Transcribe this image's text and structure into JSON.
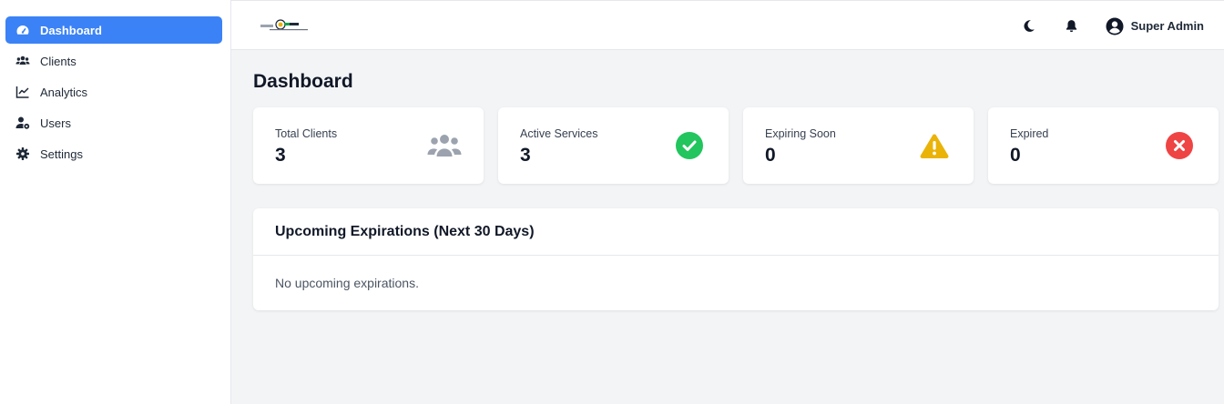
{
  "sidebar": {
    "items": [
      {
        "label": "Dashboard",
        "icon": "gauge-icon",
        "active": true
      },
      {
        "label": "Clients",
        "icon": "users-icon"
      },
      {
        "label": "Analytics",
        "icon": "chart-line-icon"
      },
      {
        "label": "Users",
        "icon": "user-gear-icon"
      },
      {
        "label": "Settings",
        "icon": "gear-icon"
      }
    ]
  },
  "header": {
    "user_name": "Super Admin",
    "icons": [
      "moon-icon",
      "bell-icon",
      "user-circle-icon"
    ]
  },
  "page": {
    "title": "Dashboard"
  },
  "stats": [
    {
      "label": "Total Clients",
      "value": "3",
      "icon": "users-icon",
      "color": "#9ca3af"
    },
    {
      "label": "Active Services",
      "value": "3",
      "icon": "check-circle-icon",
      "color": "#22c55e"
    },
    {
      "label": "Expiring Soon",
      "value": "0",
      "icon": "warning-icon",
      "color": "#eab308"
    },
    {
      "label": "Expired",
      "value": "0",
      "icon": "x-circle-icon",
      "color": "#ef4444"
    }
  ],
  "upcoming": {
    "title": "Upcoming Expirations (Next 30 Days)",
    "empty_text": "No upcoming expirations."
  },
  "colors": {
    "accent": "#3b82f6",
    "background": "#f3f4f6"
  }
}
